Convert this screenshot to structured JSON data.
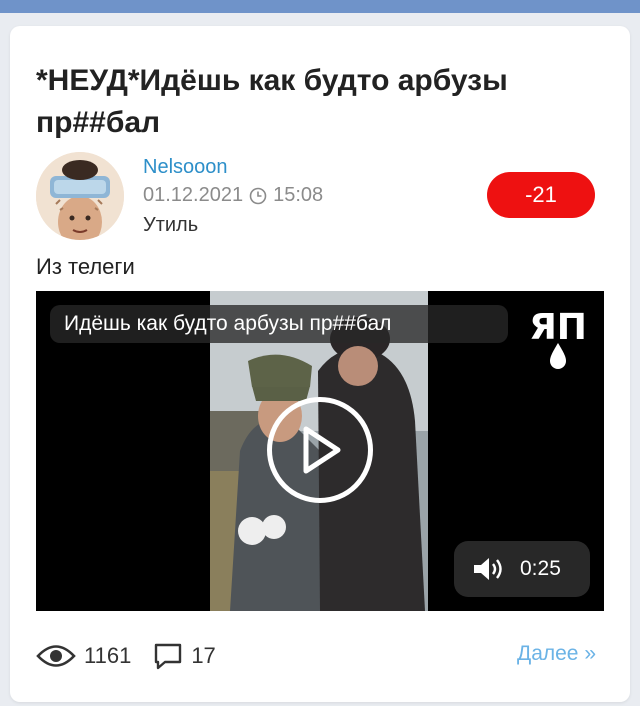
{
  "post": {
    "title": "*НЕУД*Идёшь как будто арбузы пр##бал",
    "author": "Nelsooon",
    "date": "01.12.2021",
    "time": "15:08",
    "category": "Утиль",
    "rating": "-21",
    "text": "Из телеги"
  },
  "video": {
    "title": "Идёшь как будто арбузы пр##бал",
    "duration": "0:25",
    "logo": "ЯП"
  },
  "stats": {
    "views": "1161",
    "comments": "17",
    "more_label": "Далее »"
  },
  "colors": {
    "topbar": "#6f93c9",
    "author_link": "#2d8fc9",
    "rating_badge": "#ee1111",
    "more_link": "#6bb3e6"
  }
}
